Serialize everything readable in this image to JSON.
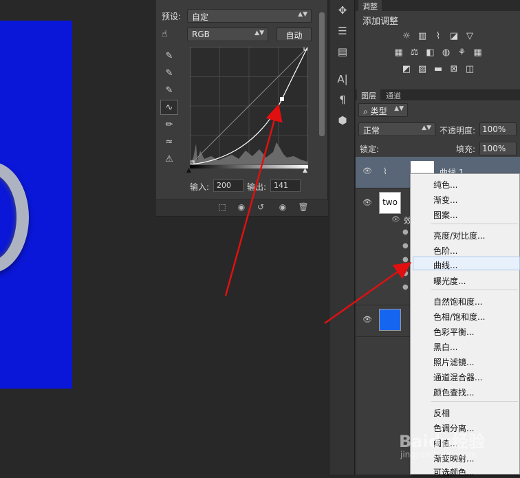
{
  "properties": {
    "preset_label": "预设:",
    "preset_value": "自定",
    "channel_value": "RGB",
    "auto_button": "自动",
    "input_label": "输入:",
    "input_value": "200",
    "output_label": "输出:",
    "output_value": "141"
  },
  "panels": {
    "adjust_tab": "调整",
    "adjust_title": "添加调整",
    "layers_tab": "图层",
    "channels_tab": "通道"
  },
  "layers": {
    "filter_type": "类型",
    "blend_mode": "正常",
    "opacity_label": "不透明度:",
    "opacity_value": "100%",
    "lock_label": "锁定:",
    "fill_label": "填充:",
    "fill_value": "100%",
    "layer1_name": "曲线 1",
    "layer2_thumb_text": "two",
    "effect_label": "效"
  },
  "menu": {
    "items": [
      "纯色...",
      "渐变...",
      "图案...",
      "亮度/对比度...",
      "色阶...",
      "曲线...",
      "曝光度...",
      "自然饱和度...",
      "色相/饱和度...",
      "色彩平衡...",
      "黑白...",
      "照片滤镜...",
      "通道混合器...",
      "颜色查找...",
      "反相",
      "色调分离...",
      "阈值...",
      "渐变映射...",
      "可选颜色..."
    ]
  },
  "watermark": {
    "main": "Baidu经验",
    "sub": "jingyan.baidu.com"
  },
  "colors": {
    "canvas_blue": "#0a17d8",
    "layer_blue": "#1565f0",
    "arrow_red": "#e01010",
    "selected_layer": "#586677"
  }
}
